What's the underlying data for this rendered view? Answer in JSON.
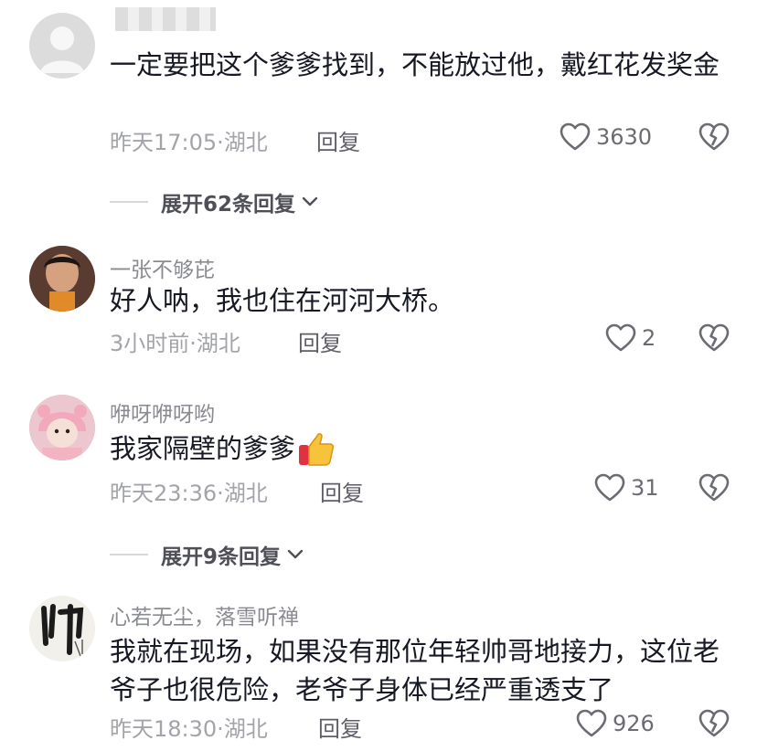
{
  "comments": [
    {
      "username": "",
      "text": "一定要把这个爹爹找到，不能放过他，戴红花发奖金",
      "time": "昨天17:05",
      "location": "湖北",
      "reply_label": "回复",
      "likes": "3630"
    },
    {
      "username": "一张不够芘",
      "text": "好人呐，我也住在河河大桥。",
      "time": "3小时前",
      "location": "湖北",
      "reply_label": "回复",
      "likes": "2"
    },
    {
      "username": "咿呀咿呀哟",
      "text": "我家隔壁的爹爹",
      "emoji": "thumbs-up",
      "time": "昨天23:36",
      "location": "湖北",
      "reply_label": "回复",
      "likes": "31"
    },
    {
      "username": "心若无尘，落雪听禅",
      "text": "我就在现场，如果没有那位年轻帅哥地接力，这位老爷子也很危险，老爷子身体已经严重透支了",
      "time": "昨天18:30",
      "location": "湖北",
      "reply_label": "回复",
      "likes": "926"
    }
  ],
  "expand_replies": [
    {
      "label": "展开62条回复"
    },
    {
      "label": "展开9条回复"
    }
  ],
  "meta_separator": "·",
  "colors": {
    "text": "#161823",
    "secondary": "#a3a4a9",
    "icon": "#6b6c73"
  }
}
